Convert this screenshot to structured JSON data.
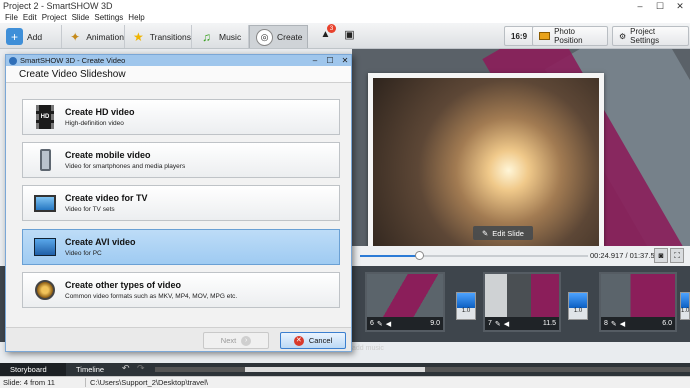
{
  "window": {
    "title": "Project 2 - SmartSHOW 3D",
    "minimize": "–",
    "maximize": "☐",
    "close": "✕"
  },
  "menu": [
    "File",
    "Edit",
    "Project",
    "Slide",
    "Settings",
    "Help"
  ],
  "toolbar": {
    "tabs": [
      "Add",
      "Animation",
      "Transitions",
      "Music",
      "Create"
    ],
    "notification_count": "3",
    "aspect_ratio": "16:9",
    "photo_position": "Photo Position",
    "project_settings": "Project Settings"
  },
  "preview": {
    "edit_slide": "Edit Slide",
    "timecode": "00:24.917 / 01:37.500",
    "progress": 0.26
  },
  "storyboard": {
    "slides": [
      {
        "number": "6",
        "duration": "9.0"
      },
      {
        "number": "7",
        "duration": "11.5"
      },
      {
        "number": "8",
        "duration": "6.0"
      }
    ],
    "transitions": [
      "1.0",
      "1.0",
      "1.0"
    ],
    "add_music": "add music"
  },
  "bottom_tabs": [
    "Storyboard",
    "Timeline"
  ],
  "status": {
    "slide": "Slide: 4 from 11",
    "path": "C:\\Users\\Support_2\\Desktop\\travel\\"
  },
  "dialog": {
    "title": "SmartSHOW 3D - Create Video",
    "heading": "Create Video Slideshow",
    "options": [
      {
        "title": "Create HD video",
        "desc": "High-definition video",
        "icon": "hd-video-icon"
      },
      {
        "title": "Create mobile video",
        "desc": "Video for smartphones and media players",
        "icon": "mobile-icon"
      },
      {
        "title": "Create video for TV",
        "desc": "Video for TV sets",
        "icon": "tv-icon"
      },
      {
        "title": "Create AVI video",
        "desc": "Video for PC",
        "icon": "avi-video-icon"
      },
      {
        "title": "Create other types of video",
        "desc": "Common video formats such as MKV, MP4, MOV, MPG etc.",
        "icon": "film-reel-icon"
      }
    ],
    "next": "Next",
    "cancel": "Cancel"
  },
  "colors": {
    "accent": "#8b1e5a",
    "selected": "#a7d0f4",
    "dialog_title": "#9fc6ec"
  }
}
